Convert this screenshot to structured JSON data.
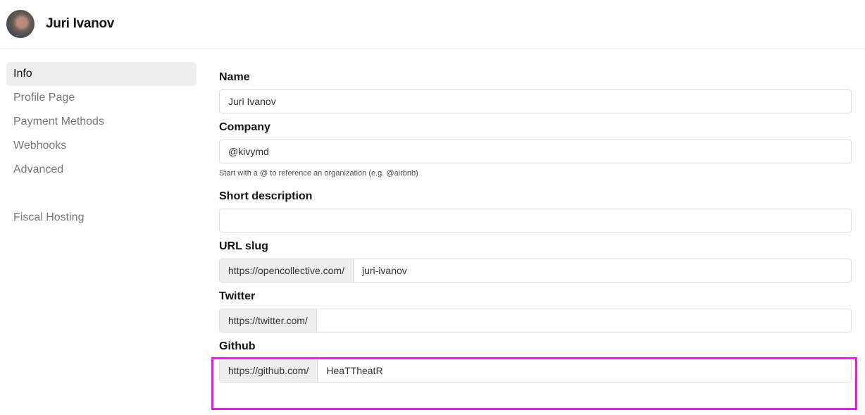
{
  "header": {
    "user_name": "Juri Ivanov"
  },
  "sidebar": {
    "items": [
      {
        "label": "Info",
        "active": true
      },
      {
        "label": "Profile Page"
      },
      {
        "label": "Payment Methods"
      },
      {
        "label": "Webhooks"
      },
      {
        "label": "Advanced"
      }
    ],
    "secondary": [
      {
        "label": "Fiscal Hosting"
      }
    ]
  },
  "form": {
    "name": {
      "label": "Name",
      "value": "Juri Ivanov"
    },
    "company": {
      "label": "Company",
      "value": "@kivymd",
      "help": "Start with a @ to reference an organization (e.g. @airbnb)"
    },
    "description": {
      "label": "Short description",
      "value": ""
    },
    "slug": {
      "label": "URL slug",
      "prefix": "https://opencollective.com/",
      "value": "juri-ivanov"
    },
    "twitter": {
      "label": "Twitter",
      "prefix": "https://twitter.com/",
      "value": ""
    },
    "github": {
      "label": "Github",
      "prefix": "https://github.com/",
      "value": "HeaTTheatR"
    }
  },
  "colors": {
    "highlight": "#ec1ce6",
    "active_bg": "#eeeeee"
  }
}
